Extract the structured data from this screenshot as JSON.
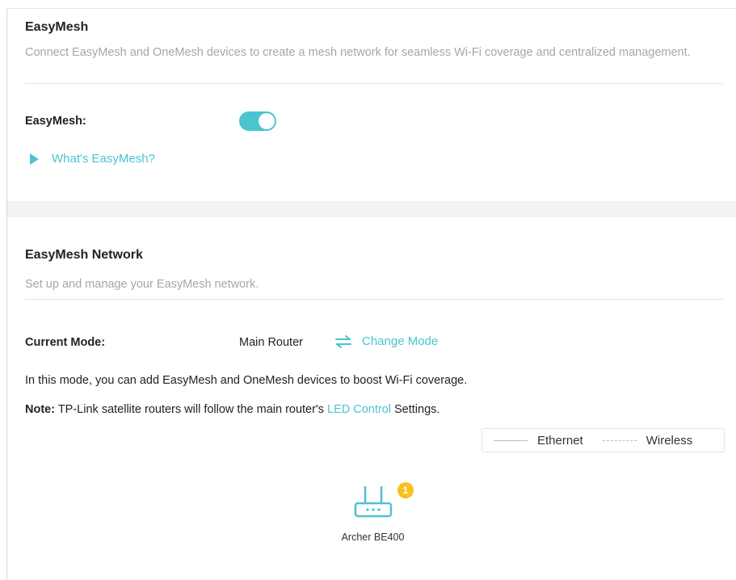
{
  "easymesh_section": {
    "title": "EasyMesh",
    "description": "Connect EasyMesh and OneMesh devices to create a mesh network for seamless Wi-Fi coverage and centralized management.",
    "toggle_label": "EasyMesh:",
    "toggle_state": "on",
    "whats_link": "What's EasyMesh?"
  },
  "network_section": {
    "title": "EasyMesh Network",
    "description": "Set up and manage your EasyMesh network.",
    "mode_label": "Current Mode:",
    "mode_value": "Main Router",
    "change_mode_label": "Change Mode",
    "mode_info": "In this mode, you can add EasyMesh and OneMesh devices to boost Wi-Fi coverage.",
    "note_prefix": "Note:",
    "note_text": " TP-Link satellite routers will follow the main router's ",
    "note_link": "LED Control",
    "note_suffix": " Settings.",
    "legend": {
      "ethernet": "Ethernet",
      "wireless": "Wireless"
    },
    "device": {
      "name": "Archer BE400",
      "badge_count": "1",
      "icon": "router-icon"
    }
  },
  "colors": {
    "accent": "#4ac4cf",
    "badge": "#f7c21b",
    "muted_text": "#a6a6a6"
  }
}
